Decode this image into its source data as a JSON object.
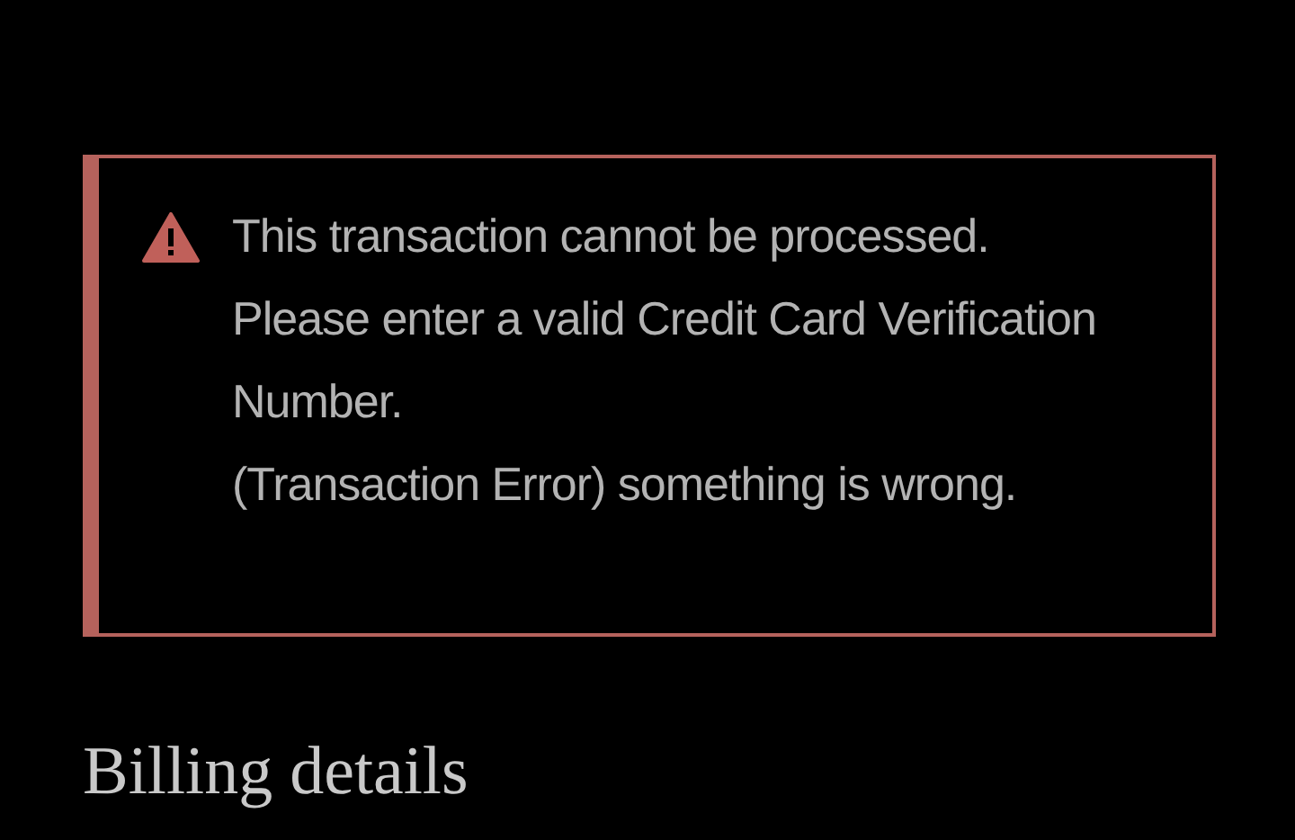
{
  "alert": {
    "kind": "error",
    "messages": [
      "This transaction cannot be processed.",
      "Please enter a valid Credit Card Verification Number.",
      "(Transaction Error) something is wrong."
    ]
  },
  "heading": "Billing details"
}
